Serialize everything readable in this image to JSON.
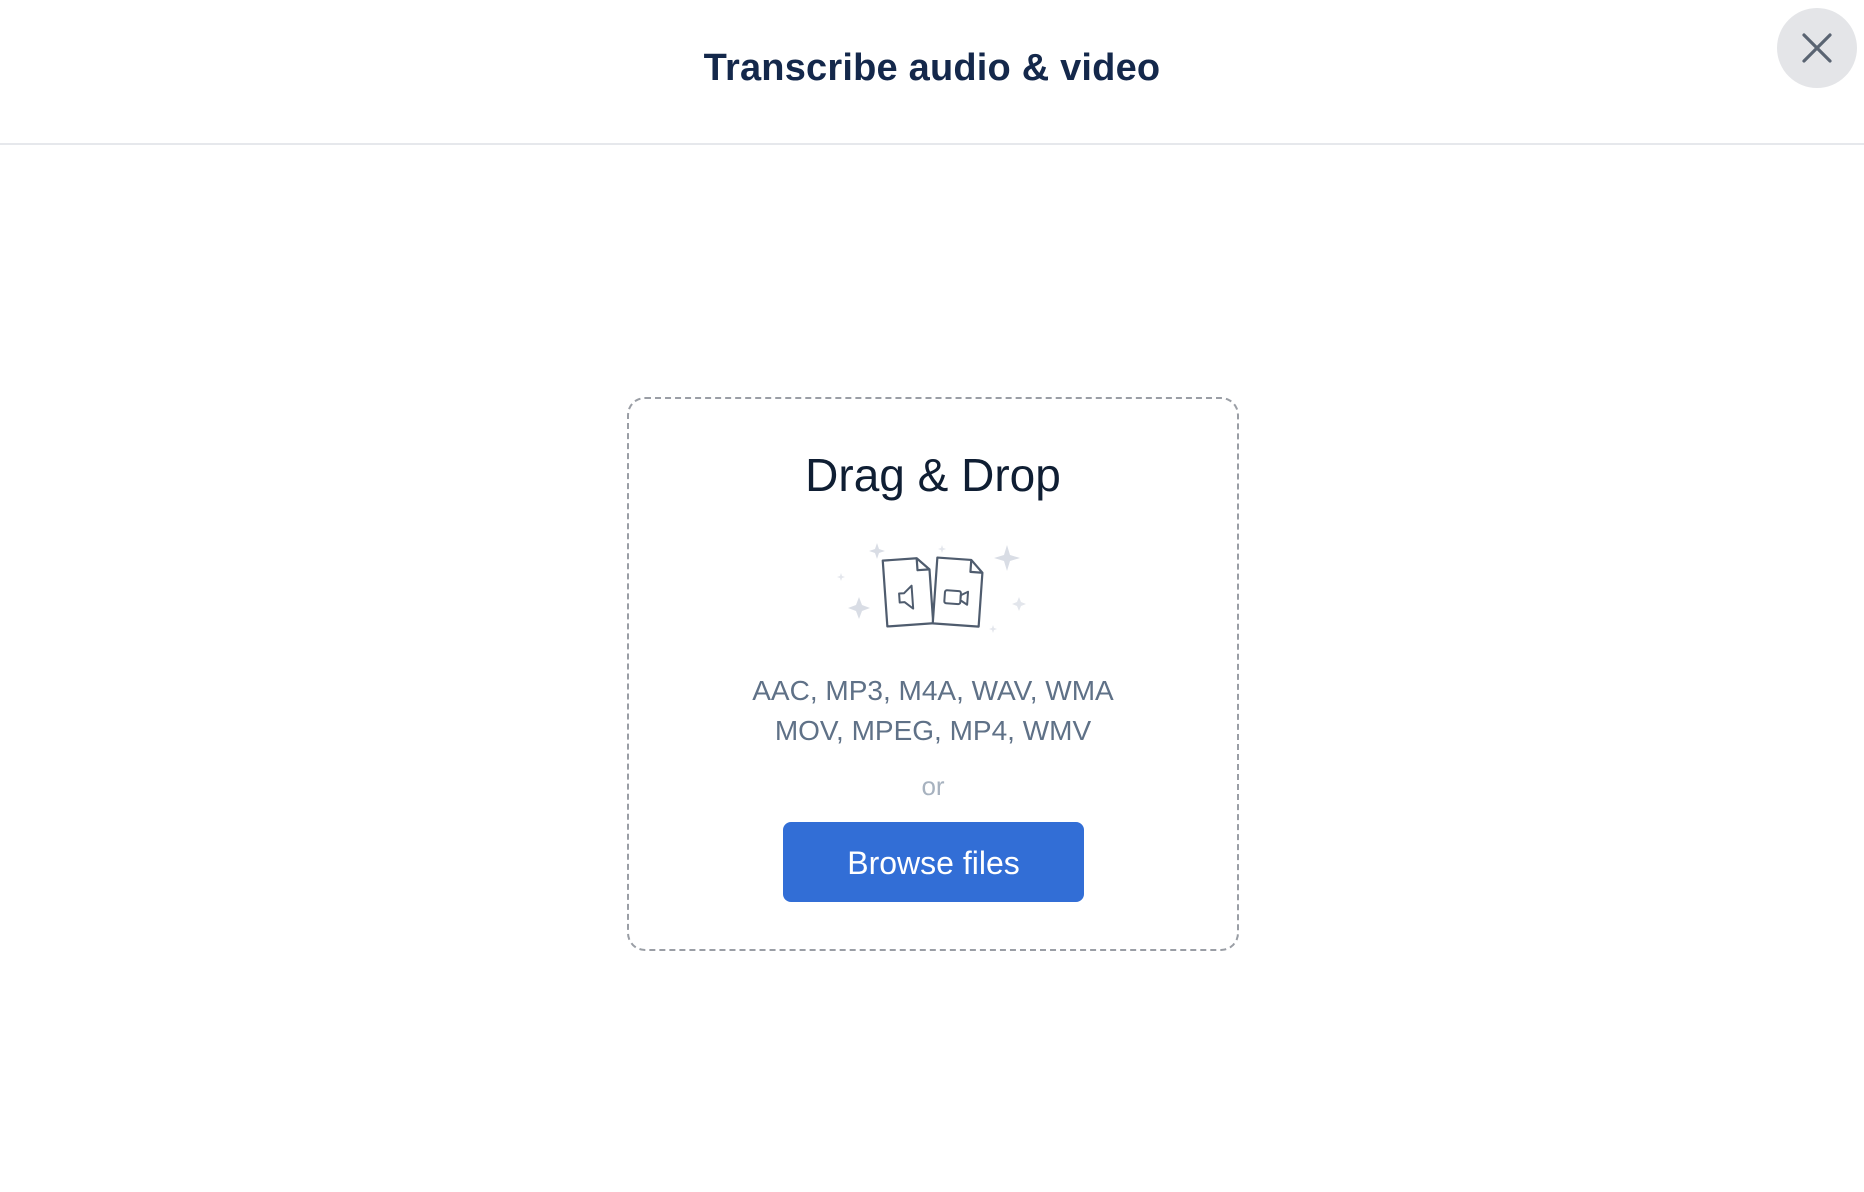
{
  "header": {
    "title": "Transcribe audio & video",
    "close_icon": "close-icon"
  },
  "dropzone": {
    "title": "Drag & Drop",
    "illustration_icon": "audio-video-files-icon",
    "formats_audio": "AAC, MP3, M4A, WAV, WMA",
    "formats_video": "MOV, MPEG, MP4, WMV",
    "or_label": "or",
    "browse_label": "Browse files"
  },
  "colors": {
    "title_text": "#14284b",
    "accent_button": "#326ed6",
    "formats_text": "#5f7187",
    "or_text": "#a7b2bf",
    "close_bg": "#e4e5e8"
  }
}
